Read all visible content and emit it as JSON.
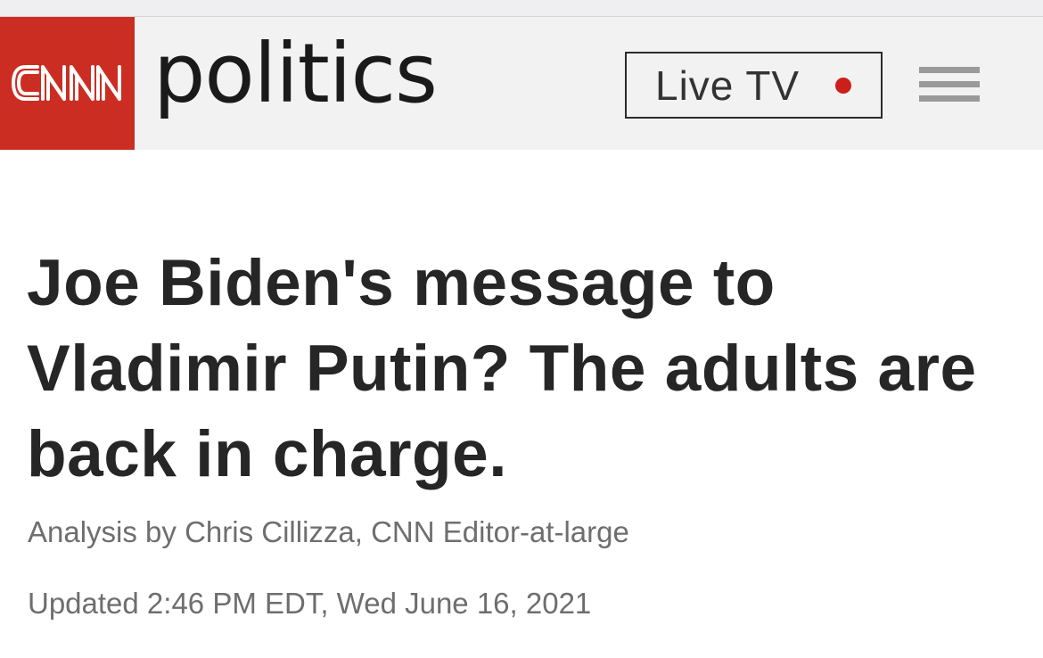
{
  "header": {
    "brand": "CNN",
    "section": "politics",
    "live_tv_label": "Live TV",
    "live_indicator_color": "#cc1f1a",
    "brand_color": "#cc2d22",
    "menu_icon": "hamburger-menu-icon"
  },
  "article": {
    "headline": "Joe Biden's message to Vladimir Putin? The adults are back in charge.",
    "byline": "Analysis by Chris Cillizza, CNN Editor-at-large",
    "updated": "Updated 2:46 PM EDT, Wed June 16, 2021"
  }
}
